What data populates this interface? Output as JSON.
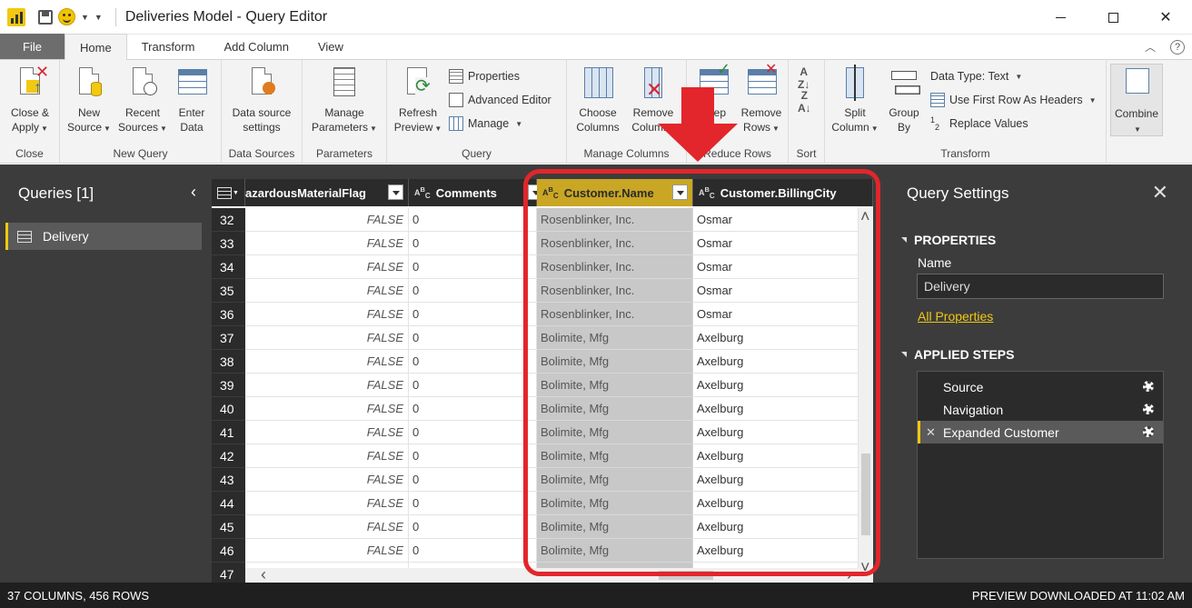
{
  "window": {
    "title": "Deliveries Model - Query Editor",
    "minimize_icon": "minimize-icon",
    "maximize_icon": "maximize-icon",
    "close_glyph": "✕"
  },
  "menu": {
    "tabs": [
      "File",
      "Home",
      "Transform",
      "Add Column",
      "View"
    ],
    "active": "Home"
  },
  "ribbon": {
    "groups": [
      {
        "label": "Close",
        "buttons": [
          {
            "line1": "Close &",
            "line2": "Apply"
          }
        ]
      },
      {
        "label": "New Query",
        "buttons": [
          {
            "line1": "New",
            "line2": "Source"
          },
          {
            "line1": "Recent",
            "line2": "Sources"
          },
          {
            "line1": "Enter",
            "line2": "Data"
          }
        ]
      },
      {
        "label": "Data Sources",
        "buttons": [
          {
            "line1": "Data source",
            "line2": "settings"
          }
        ]
      },
      {
        "label": "Parameters",
        "buttons": [
          {
            "line1": "Manage",
            "line2": "Parameters"
          }
        ]
      },
      {
        "label": "Query",
        "buttons": [
          {
            "line1": "Refresh",
            "line2": "Preview"
          }
        ],
        "small": [
          "Properties",
          "Advanced Editor",
          "Manage"
        ]
      },
      {
        "label": "Manage Columns",
        "buttons": [
          {
            "line1": "Choose",
            "line2": "Columns"
          },
          {
            "line1": "Remove",
            "line2": "Columns"
          }
        ]
      },
      {
        "label": "Reduce Rows",
        "buttons": [
          {
            "line1": "Keep",
            "line2": "Rows"
          },
          {
            "line1": "Remove",
            "line2": "Rows"
          }
        ]
      },
      {
        "label": "Sort",
        "buttons": []
      },
      {
        "label": "Transform",
        "buttons": [
          {
            "line1": "Split",
            "line2": "Column"
          },
          {
            "line1": "Group",
            "line2": "By"
          }
        ],
        "small": [
          "Data Type: Text",
          "Use First Row As Headers",
          "Replace Values"
        ]
      },
      {
        "label": "",
        "buttons": [
          {
            "line1": "Combine",
            "line2": ""
          }
        ]
      }
    ]
  },
  "queries": {
    "header": "Queries [1]",
    "items": [
      "Delivery"
    ]
  },
  "grid": {
    "columns": [
      {
        "name": "azardousMaterialFlag",
        "type": "",
        "selected": false
      },
      {
        "name": "Comments",
        "type": "ABC",
        "selected": false
      },
      {
        "name": "Customer.Name",
        "type": "ABC",
        "selected": true
      },
      {
        "name": "Customer.BillingCity",
        "type": "ABC",
        "selected": false
      }
    ],
    "rows": [
      {
        "n": "32",
        "flag": "FALSE",
        "comments": "0",
        "name": "Rosenblinker, Inc.",
        "city": "Osmar"
      },
      {
        "n": "33",
        "flag": "FALSE",
        "comments": "0",
        "name": "Rosenblinker, Inc.",
        "city": "Osmar"
      },
      {
        "n": "34",
        "flag": "FALSE",
        "comments": "0",
        "name": "Rosenblinker, Inc.",
        "city": "Osmar"
      },
      {
        "n": "35",
        "flag": "FALSE",
        "comments": "0",
        "name": "Rosenblinker, Inc.",
        "city": "Osmar"
      },
      {
        "n": "36",
        "flag": "FALSE",
        "comments": "0",
        "name": "Rosenblinker, Inc.",
        "city": "Osmar"
      },
      {
        "n": "37",
        "flag": "FALSE",
        "comments": "0",
        "name": "Bolimite, Mfg",
        "city": "Axelburg"
      },
      {
        "n": "38",
        "flag": "FALSE",
        "comments": "0",
        "name": "Bolimite, Mfg",
        "city": "Axelburg"
      },
      {
        "n": "39",
        "flag": "FALSE",
        "comments": "0",
        "name": "Bolimite, Mfg",
        "city": "Axelburg"
      },
      {
        "n": "40",
        "flag": "FALSE",
        "comments": "0",
        "name": "Bolimite, Mfg",
        "city": "Axelburg"
      },
      {
        "n": "41",
        "flag": "FALSE",
        "comments": "0",
        "name": "Bolimite, Mfg",
        "city": "Axelburg"
      },
      {
        "n": "42",
        "flag": "FALSE",
        "comments": "0",
        "name": "Bolimite, Mfg",
        "city": "Axelburg"
      },
      {
        "n": "43",
        "flag": "FALSE",
        "comments": "0",
        "name": "Bolimite, Mfg",
        "city": "Axelburg"
      },
      {
        "n": "44",
        "flag": "FALSE",
        "comments": "0",
        "name": "Bolimite, Mfg",
        "city": "Axelburg"
      },
      {
        "n": "45",
        "flag": "FALSE",
        "comments": "0",
        "name": "Bolimite, Mfg",
        "city": "Axelburg"
      },
      {
        "n": "46",
        "flag": "FALSE",
        "comments": "0",
        "name": "Bolimite, Mfg",
        "city": "Axelburg"
      },
      {
        "n": "47",
        "flag": "",
        "comments": "",
        "name": "",
        "city": ""
      }
    ]
  },
  "settings": {
    "title": "Query Settings",
    "properties_header": "PROPERTIES",
    "name_label": "Name",
    "name_value": "Delivery",
    "all_properties": "All Properties",
    "steps_header": "APPLIED STEPS",
    "steps": [
      "Source",
      "Navigation",
      "Expanded Customer"
    ],
    "active_step": "Expanded Customer"
  },
  "status": {
    "left": "37 COLUMNS, 456 ROWS",
    "right": "PREVIEW DOWNLOADED AT 11:02 AM"
  },
  "colors": {
    "accent": "#f2c811",
    "annotation": "#e2262b"
  }
}
